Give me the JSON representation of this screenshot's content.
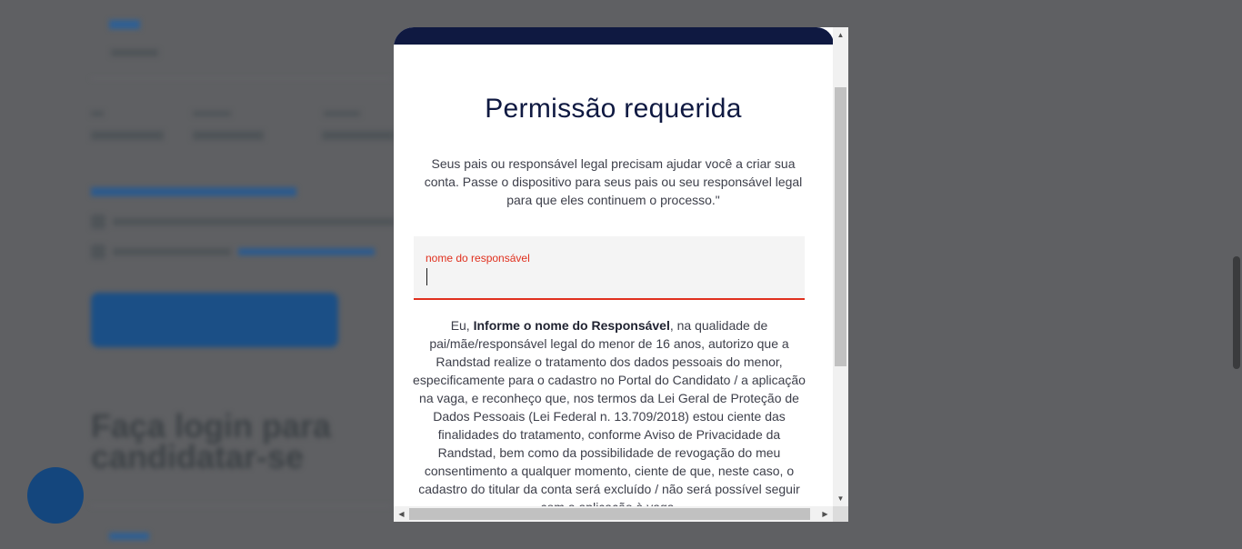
{
  "background": {
    "login_heading": "Faça login para candidatar-se"
  },
  "modal": {
    "title": "Permissão requerida",
    "description": "Seus pais ou responsável legal precisam ajudar você a criar sua conta. Passe o dispositivo para seus pais ou seu responsável legal para que eles continuem o processo.\"",
    "guardian_field": {
      "label": "nome do responsável",
      "value": ""
    },
    "consent": {
      "prefix": "Eu, ",
      "placeholder_name": "Informe o nome do Responsável",
      "body": ", na qualidade de pai/mãe/responsável legal do menor de 16 anos, autorizo que a Randstad realize o tratamento dos dados pessoais do menor, especificamente para o cadastro no Portal do Candidato / a aplicação na vaga, e reconheço que, nos termos da Lei Geral de Proteção de Dados Pessoais (Lei Federal n. 13.709/2018) estou ciente das finalidades do tratamento, conforme Aviso de Privacidade da Randstad, bem como da possibilidade de revogação do meu consentimento a qualquer momento, ciente de que, neste caso, o cadastro do titular da conta será excluído / não será possível seguir com a aplicação à vaga."
    }
  },
  "icons": {
    "scroll_up": "▲",
    "scroll_down": "▼",
    "scroll_left": "◀",
    "scroll_right": "▶"
  },
  "colors": {
    "brand_navy": "#0f1941",
    "error_red": "#e0301e",
    "overlay": "#5f6063"
  }
}
